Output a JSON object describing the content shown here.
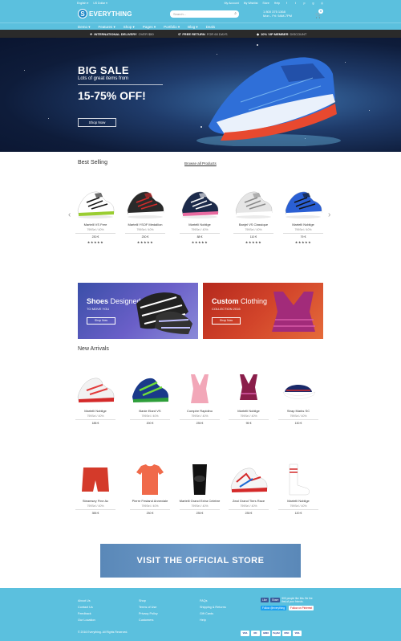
{
  "topbar": {
    "language": "English ▾",
    "currency": "US Dollar ▾",
    "links": [
      "My Account",
      "My Wishlist",
      "Store",
      "Help"
    ],
    "social": [
      "facebook-icon",
      "twitter-icon",
      "pinterest-icon",
      "google-plus-icon",
      "instagram-icon"
    ]
  },
  "header": {
    "logo_letter": "S",
    "logo_text": "EVERYTHING",
    "search_placeholder": "Search...",
    "phone_line1": "1 800 375 1368",
    "phone_line2": "Mon - Fri: 9AM-7PM",
    "cart_count": "0"
  },
  "nav": [
    "Demo ▾",
    "Features ▾",
    "Shop ▾",
    "Pages ▾",
    "Portfolio ▾",
    "Blog ▾",
    "Deals"
  ],
  "promo": [
    {
      "bold": "INTERNATIONAL DELIVERY",
      "sub": "OVER $50"
    },
    {
      "bold": "FREE RETURN",
      "sub": "FOR 60 DAYS"
    },
    {
      "bold": "10% VIP MEMBER",
      "sub": "DISCOUNT"
    }
  ],
  "hero": {
    "title": "BIG SALE",
    "subtitle": "Lots of great items from",
    "offer": "15-75% OFF!",
    "button": "Shop Now"
  },
  "best_selling": {
    "title": "Best Selling",
    "browse": "Browse all Products",
    "products": [
      {
        "name": "Martelli VS Free",
        "price": "799SeI / 40%",
        "current": "230 €",
        "stars": "★★★★★",
        "colors": [
          "#ffffff",
          "#111111",
          "#9acd32"
        ]
      },
      {
        "name": "Martelli YSOF Medallion",
        "price": "799SeI / 40%",
        "current": "230 €",
        "stars": "★★★★★",
        "colors": [
          "#2a2a2a",
          "#d42a2a",
          "#ffffff"
        ]
      },
      {
        "name": "Martelli Noblige",
        "price": "799SeI / 40%",
        "current": "88 €",
        "stars": "★★★★★",
        "colors": [
          "#1c2a4a",
          "#ffffff",
          "#e86aa0"
        ]
      },
      {
        "name": "Banjel VS Classique",
        "price": "799SeI / 40%",
        "current": "110 €",
        "stars": "★★★★★",
        "colors": [
          "#e5e5e5",
          "#888888",
          "#ffffff"
        ]
      },
      {
        "name": "Martelli Noblige",
        "price": "799SeI / 40%",
        "current": "79 €",
        "stars": "★★★★★",
        "colors": [
          "#2a5fd4",
          "#111111",
          "#ffffff"
        ]
      }
    ]
  },
  "banners": [
    {
      "title_a": "Shoes",
      "title_b": " Designed",
      "sub": "TO MOVE YOU",
      "button": "Shop Now"
    },
    {
      "title_a": "Custom",
      "title_b": " Clothing",
      "sub": "COLLECTION 2016",
      "button": "Shop Now"
    }
  ],
  "new_arrivals": {
    "title": "New Arrivals",
    "row1": [
      {
        "name": "Martelli Noblige",
        "price": "799SeI / 40%",
        "current": "188 €"
      },
      {
        "name": "Banie Elard VS",
        "price": "799SeI / 40%",
        "current": "200 €"
      },
      {
        "name": "Compire Rapidino",
        "price": "799SeI / 40%",
        "current": "235 €"
      },
      {
        "name": "Martelli Noblige",
        "price": "799SeI / 40%",
        "current": "95 €"
      },
      {
        "name": "Strap Marks SC",
        "price": "799SeI / 40%",
        "current": "130 €"
      }
    ],
    "row2": [
      {
        "name": "Steamsey Fine Ac",
        "price": "799SeI / 40%",
        "current": "355 €"
      },
      {
        "name": "Pierre Festand Annexiale",
        "price": "799SeI / 40%",
        "current": "230 €"
      },
      {
        "name": "Martelli Grand Extra Celebre",
        "price": "799SeI / 40%",
        "current": "235 €"
      },
      {
        "name": "Zeal Grand Tiers Race",
        "price": "799SeI / 40%",
        "current": "235 €"
      },
      {
        "name": "Martelli Noblige",
        "price": "799SeI / 40%",
        "current": "120 €"
      }
    ]
  },
  "store_banner": "VISIT THE OFFICIAL STORE",
  "footer": {
    "col1": [
      "About Us",
      "Contact Us",
      "Feedback",
      "Our Location"
    ],
    "col2": [
      "Shop",
      "Terms of Use",
      "Privacy Policy",
      "Customers"
    ],
    "col3": [
      "FAQs",
      "Shipping & Returns",
      "Gift Cards",
      "Help"
    ],
    "fb_label": "Like",
    "fb_share": "Share",
    "fb_text": "500 people like this. Be the first of your friends.",
    "tw_label": "Follow @everything",
    "pin_label": "Follow on Pinterest",
    "copyright": "© 2016 Everything. All Rights Reserved.",
    "payments": [
      "VISA",
      "MC",
      "AMEX",
      "PayPal",
      "DISC",
      "VISA"
    ]
  }
}
